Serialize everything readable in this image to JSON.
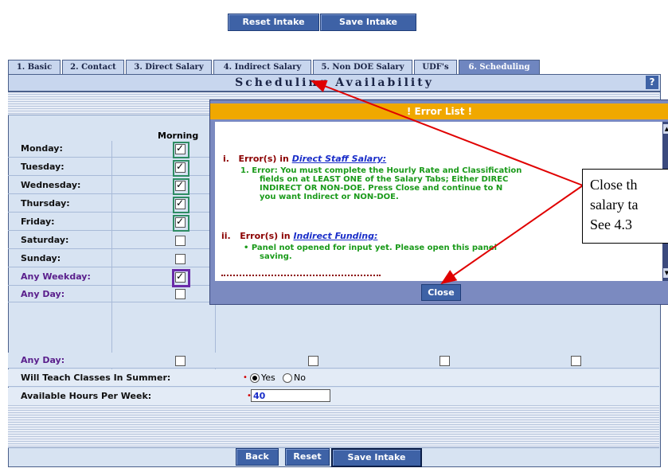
{
  "top_buttons": {
    "reset": "Reset Intake",
    "save": "Save Intake"
  },
  "tabs": [
    "1. Basic",
    "2. Contact",
    "3. Direct Salary",
    "4. Indirect Salary",
    "5. Non DOE Salary",
    "UDF's",
    "6. Scheduling"
  ],
  "section_title": "Scheduling Availability",
  "help": "?",
  "column_header": "Morning",
  "days": [
    "Monday:",
    "Tuesday:",
    "Wednesday:",
    "Thursday:",
    "Friday:",
    "Saturday:",
    "Sunday:",
    "Any Weekday:",
    "Any Day:"
  ],
  "summer": {
    "label": "Will Teach Classes In Summer:",
    "yes": "Yes",
    "no": "No"
  },
  "hours": {
    "label": "Available Hours Per Week:",
    "value": "40"
  },
  "bottom_buttons": {
    "back": "Back",
    "reset": "Reset",
    "save": "Save Intake"
  },
  "dialog": {
    "title": "! Error List !",
    "error1_numeral": "i.",
    "error1_prefix": "Error(s) in",
    "error1_link": "Direct Staff Salary:",
    "error1_line1": "1.   Error: You must complete the Hourly Rate and Classification",
    "error1_line2": "fields on at LEAST ONE of the Salary Tabs; Either DIREC",
    "error1_line3": "INDIRECT OR NON-DOE. Press Close and continue to N",
    "error1_line4": "you want Indirect or NON-DOE.",
    "error2_numeral": "ii.",
    "error2_prefix": "Error(s) in",
    "error2_link": "Indirect Funding:",
    "error2_line1": "•  Panel not opened for input yet. Please open this panel",
    "error2_line2": "saving.",
    "close": "Close"
  },
  "callout": {
    "line1": "Close th",
    "line2": "salary ta",
    "line3": "See 4.3"
  },
  "colors": {
    "button": "#3e62a6",
    "dialog_title": "#f0a800",
    "error_text": "#1a9a1a",
    "arrow": "#e00000"
  }
}
